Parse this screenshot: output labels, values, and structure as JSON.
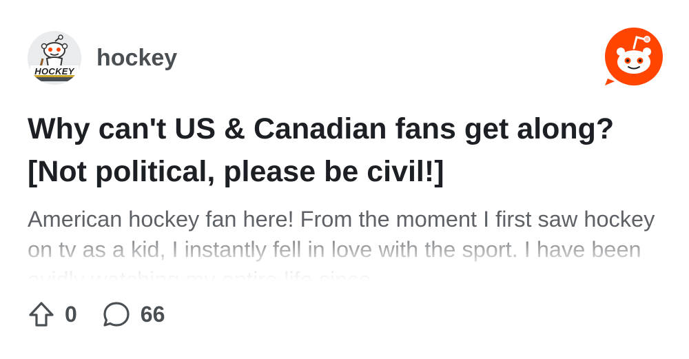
{
  "subreddit": {
    "name": "hockey",
    "avatar_text": "HOCKEY",
    "avatar_icon": "hockey-snoo-icon"
  },
  "brand": {
    "icon": "reddit-snoo-icon",
    "color": "#ff4500"
  },
  "post": {
    "title": "Why can't US & Canadian fans get along? [Not political, please be civil!]",
    "body": "American hockey fan here! From the moment I first saw hockey on tv as a kid, I instantly fell in love with the sport. I have been avidly watching my entire life since"
  },
  "stats": {
    "upvotes": "0",
    "upvote_icon": "upvote-arrow-icon",
    "comments": "66",
    "comment_icon": "comment-bubble-icon"
  }
}
